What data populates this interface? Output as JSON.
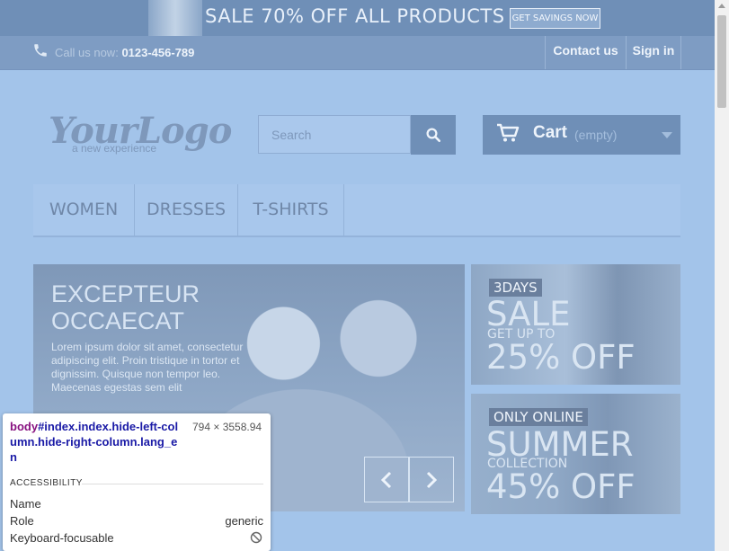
{
  "promo": {
    "text": "SALE 70% OFF ALL PRODUCTS",
    "button": "GET SAVINGS NOW"
  },
  "topnav": {
    "call_label": "Call us now:",
    "phone": "0123-456-789",
    "contact": "Contact us",
    "signin": "Sign in",
    "icon": "phone-icon"
  },
  "logo": {
    "main": "YourLogo",
    "sub": "a new experience"
  },
  "search": {
    "placeholder": "Search",
    "icon": "search-icon"
  },
  "cart": {
    "label": "Cart",
    "status": "(empty)",
    "icon": "cart-icon"
  },
  "menu": {
    "items": [
      "WOMEN",
      "DRESSES",
      "T-SHIRTS"
    ]
  },
  "slider": {
    "title_line1": "EXCEPTEUR",
    "title_line2": "OCCAECAT",
    "text": "Lorem ipsum dolor sit amet, consectetur adipiscing elit. Proin tristique in tortor et dignissim. Quisque non tempor leo. Maecenas egestas sem elit"
  },
  "banners": [
    {
      "badge": "3DAYS",
      "big": "SALE",
      "small": "GET UP TO",
      "offer": "25% OFF"
    },
    {
      "badge": "ONLY ONLINE",
      "big": "SUMMER",
      "small": "COLLECTION",
      "offer": "45% OFF"
    }
  ],
  "devtools": {
    "tag": "body",
    "selector": "#index.index.hide-left-column.hide-right-column.lang_en",
    "dimensions": "794 × 3558.94",
    "section": "ACCESSIBILITY",
    "rows": [
      {
        "key": "Name",
        "value": ""
      },
      {
        "key": "Role",
        "value": "generic"
      },
      {
        "key": "Keyboard-focusable",
        "value": ""
      }
    ]
  }
}
